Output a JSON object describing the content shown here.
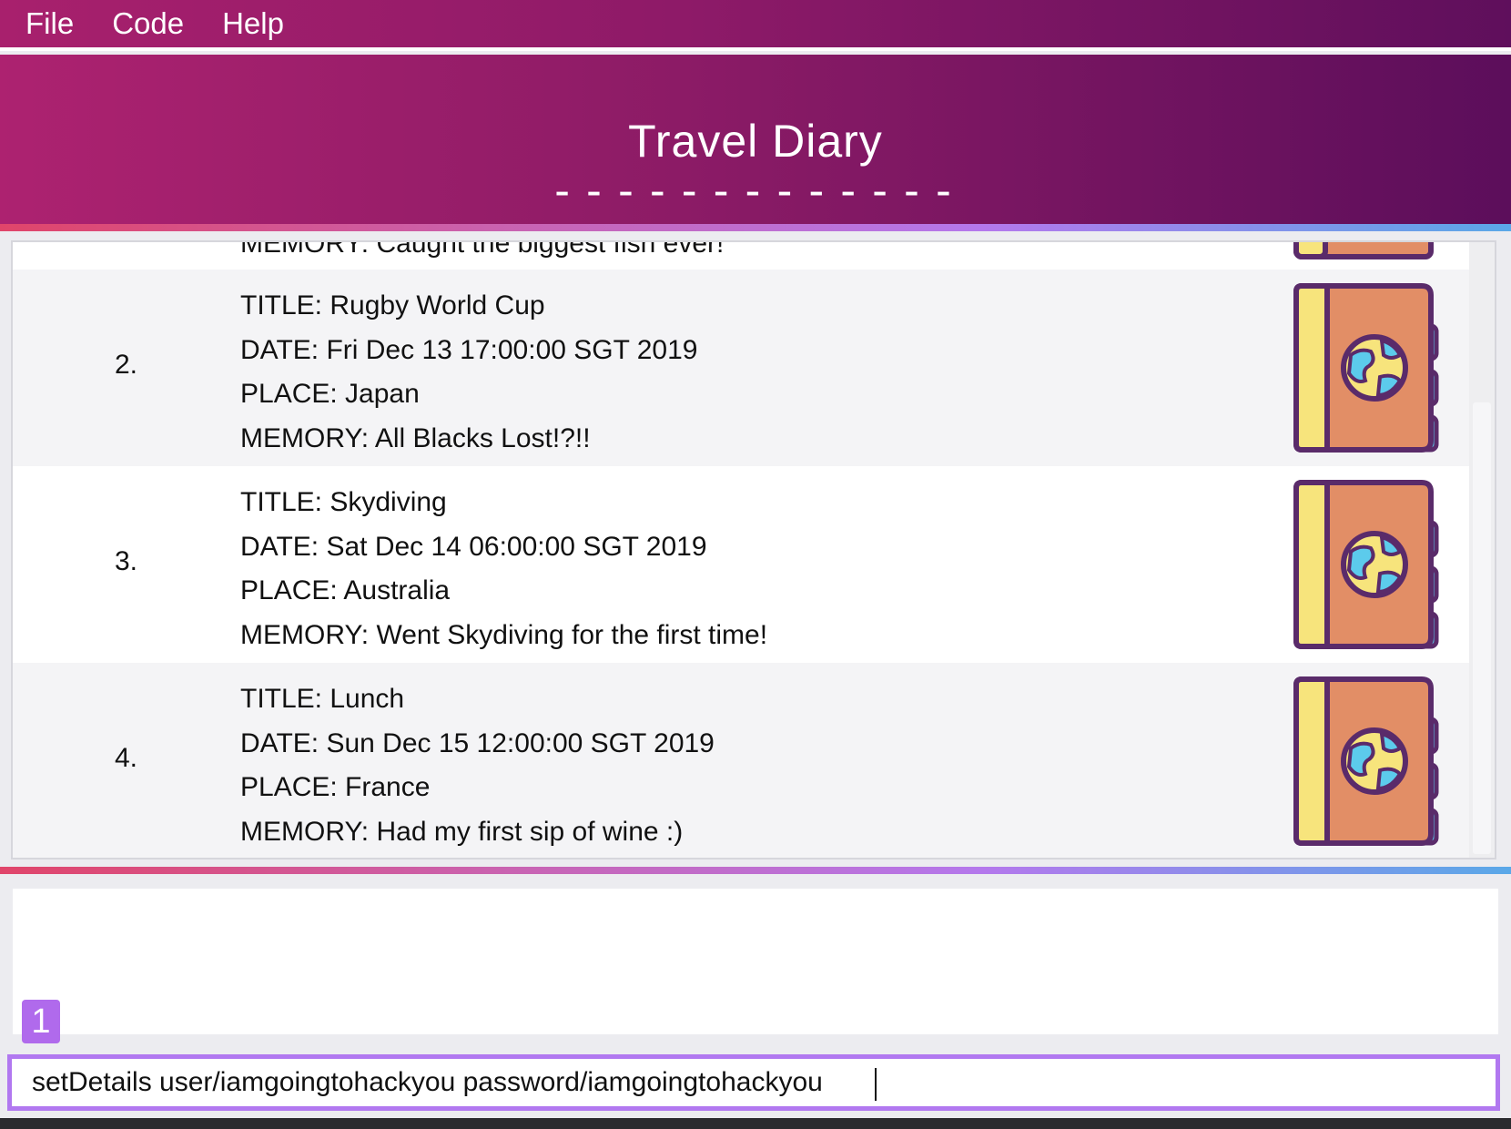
{
  "menu": {
    "items": [
      "File",
      "Code",
      "Help"
    ]
  },
  "header": {
    "title": "Travel Diary",
    "underline": "-------------"
  },
  "entries": [
    {
      "index": "",
      "lines": [
        "MEMORY: Caught the biggest fish ever!"
      ]
    },
    {
      "index": "2.",
      "lines": [
        "TITLE: Rugby World Cup",
        "DATE: Fri Dec 13 17:00:00 SGT 2019",
        "PLACE: Japan",
        "MEMORY: All Blacks Lost!?!!"
      ]
    },
    {
      "index": "3.",
      "lines": [
        "TITLE: Skydiving",
        "DATE: Sat Dec 14 06:00:00 SGT 2019",
        "PLACE: Australia",
        "MEMORY: Went Skydiving for the first time!"
      ]
    },
    {
      "index": "4.",
      "lines": [
        "TITLE: Lunch",
        "DATE: Sun Dec 15 12:00:00 SGT 2019",
        "PLACE: France",
        "MEMORY: Had my first sip of wine :)"
      ]
    }
  ],
  "badge": "1",
  "command": {
    "value": "setDetails user/iamgoingtohackyou password/iamgoingtohackyou"
  },
  "icon": "passport-globe-icon",
  "colors": {
    "header_start": "#ad2270",
    "header_end": "#5c0e5b",
    "accent": "#b178f0"
  }
}
